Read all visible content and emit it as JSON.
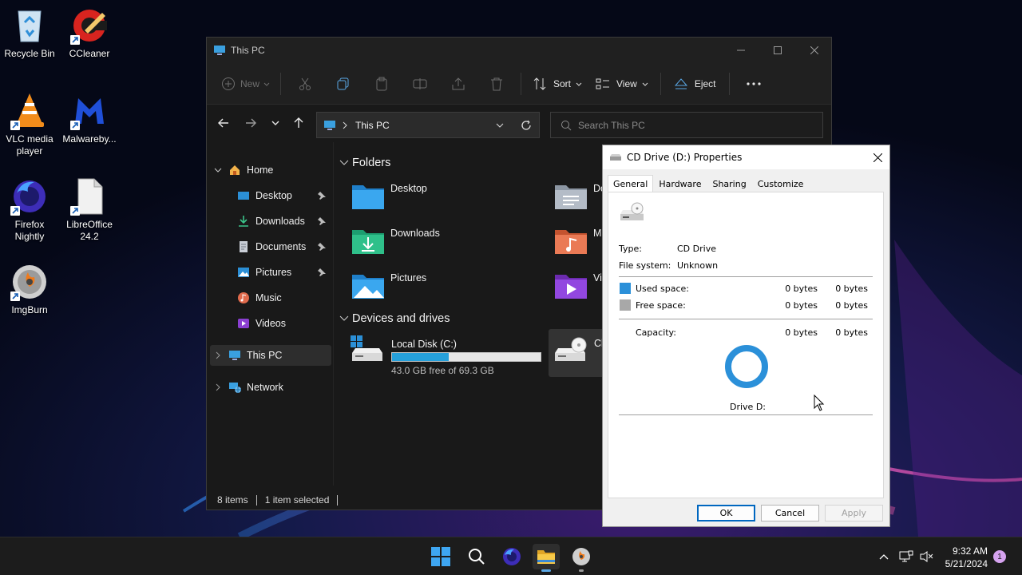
{
  "desktop": {
    "icons": [
      {
        "label": "Recycle Bin",
        "icon": "recycle-bin-icon"
      },
      {
        "label": "CCleaner",
        "icon": "ccleaner-icon"
      },
      {
        "label": "VLC media player",
        "icon": "vlc-icon"
      },
      {
        "label": "Malwareby...",
        "icon": "malwarebytes-icon"
      },
      {
        "label": "Firefox Nightly",
        "icon": "firefox-nightly-icon"
      },
      {
        "label": "LibreOffice 24.2",
        "icon": "libreoffice-icon"
      },
      {
        "label": "ImgBurn",
        "icon": "imgburn-icon"
      }
    ]
  },
  "explorer": {
    "title": "This PC",
    "toolbar": {
      "new_label": "New",
      "sort_label": "Sort",
      "view_label": "View",
      "eject_label": "Eject"
    },
    "address": {
      "location": "This PC",
      "search_placeholder": "Search This PC"
    },
    "nav": {
      "home": "Home",
      "quick": [
        "Desktop",
        "Downloads",
        "Documents",
        "Pictures",
        "Music",
        "Videos"
      ],
      "this_pc": "This PC",
      "network": "Network"
    },
    "folders_heading": "Folders",
    "folders": [
      "Desktop",
      "Downloads",
      "Pictures"
    ],
    "folders_partial": [
      "Do",
      "M",
      "Vi"
    ],
    "devices_heading": "Devices and drives",
    "drive_c": {
      "name": "Local Disk (C:)",
      "free_text": "43.0 GB free of 69.3 GB",
      "used_fraction": 0.38
    },
    "drive_d_partial": "Cl",
    "status": {
      "items": "8 items",
      "selected": "1 item selected"
    }
  },
  "dialog": {
    "title": "CD Drive (D:) Properties",
    "tabs": [
      "General",
      "Hardware",
      "Sharing",
      "Customize"
    ],
    "type_label": "Type:",
    "type_value": "CD Drive",
    "fs_label": "File system:",
    "fs_value": "Unknown",
    "used_label": "Used space:",
    "used_bytes": "0 bytes",
    "used_size": "0 bytes",
    "free_label": "Free space:",
    "free_bytes": "0 bytes",
    "free_size": "0 bytes",
    "cap_label": "Capacity:",
    "cap_bytes": "0 bytes",
    "cap_size": "0 bytes",
    "drive_label": "Drive D:",
    "ok": "OK",
    "cancel": "Cancel",
    "apply": "Apply",
    "colors": {
      "used": "#2b90d9",
      "free": "#a8a8a8"
    }
  },
  "taskbar": {
    "time": "9:32 AM",
    "date": "5/21/2024",
    "notification_count": "1"
  }
}
